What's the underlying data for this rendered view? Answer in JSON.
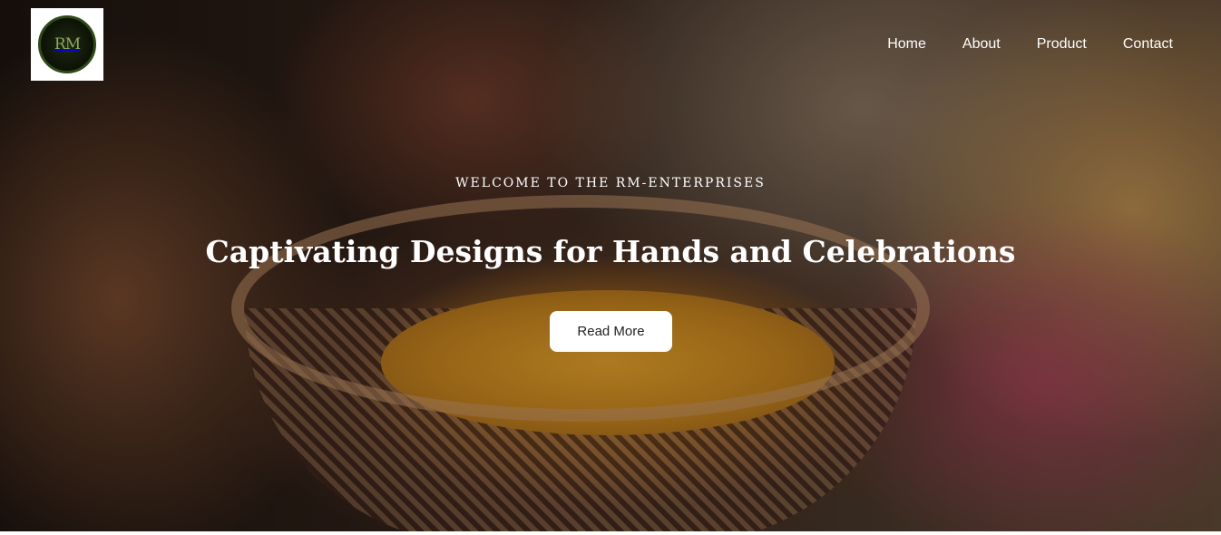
{
  "brand": {
    "logo_text": "RM"
  },
  "nav": {
    "items": [
      "Home",
      "About",
      "Product",
      "Contact"
    ]
  },
  "hero": {
    "kicker": "WELCOME TO THE RM-ENTERPRISES",
    "headline": "Captivating Designs for Hands and Celebrations",
    "button_label": "Read More"
  }
}
